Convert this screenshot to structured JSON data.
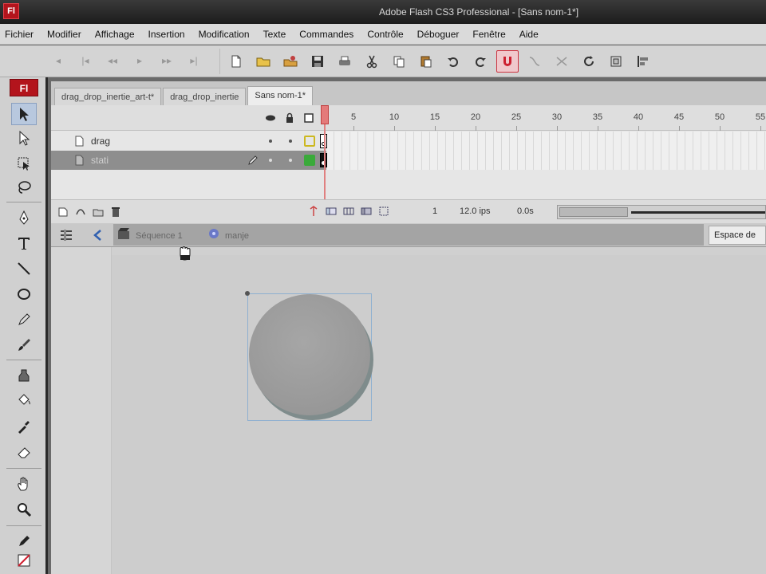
{
  "window": {
    "title": "Adobe Flash CS3 Professional - [Sans nom-1*]",
    "app_icon_label": "Fl"
  },
  "menu": {
    "items": [
      "Fichier",
      "Modifier",
      "Affichage",
      "Insertion",
      "Modification",
      "Texte",
      "Commandes",
      "Contrôle",
      "Déboguer",
      "Fenêtre",
      "Aide"
    ]
  },
  "toolbar": {
    "buttons": [
      "new-document",
      "open-folder",
      "open-from-web",
      "save",
      "print",
      "cut",
      "copy",
      "paste",
      "undo",
      "redo",
      "snap-magnet",
      "smooth",
      "straighten",
      "rotate",
      "scale",
      "align"
    ],
    "active_button": "snap-magnet"
  },
  "tools_panel": {
    "badge": "Fl",
    "tools": [
      "selection",
      "subselection",
      "free-transform",
      "lasso",
      "pen",
      "text",
      "line",
      "oval",
      "pencil",
      "brush",
      "ink-bottle",
      "paint-bucket",
      "eyedropper",
      "eraser",
      "hand",
      "zoom",
      "stroke-color",
      "fill-color"
    ],
    "selected_tool": "selection"
  },
  "doc_tabs": {
    "tabs": [
      {
        "label": "drag_drop_inertie_art-t*"
      },
      {
        "label": "drag_drop_inertie"
      },
      {
        "label": "Sans nom-1*"
      }
    ],
    "active_index": 2
  },
  "timeline": {
    "frame_numbers": [
      "5",
      "10",
      "15",
      "20",
      "25",
      "30",
      "35",
      "40",
      "45",
      "50",
      "55"
    ],
    "layers": [
      {
        "name": "drag",
        "selected": false,
        "outline_color": "#ccb820"
      },
      {
        "name": "stati",
        "selected": true,
        "outline_color": "#3aaa3a"
      }
    ],
    "current_frame": "1",
    "frame_rate": "12.0 ips",
    "elapsed_time": "0.0s"
  },
  "edit_bar": {
    "crumbs": [
      "Séquence 1",
      "manje"
    ],
    "workspace_label": "Espace de"
  },
  "stage": {
    "circle_color": "#9c9c9c",
    "stage_color": "#cdcdcd",
    "selection_color": "#8fb0d0"
  },
  "colors": {
    "accent": "#b3141c",
    "playhead": "#e47a7a"
  }
}
